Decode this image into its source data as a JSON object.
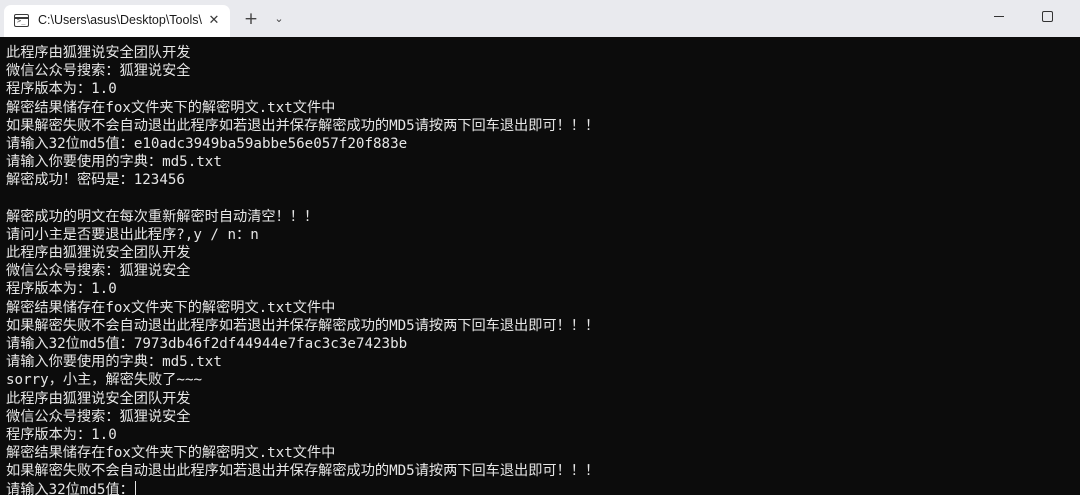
{
  "tab": {
    "title": "C:\\Users\\asus\\Desktop\\Tools\\",
    "close_glyph": "✕",
    "new_tab_glyph": "+",
    "dropdown_glyph": "⌄",
    "icon": "terminal-icon",
    "icon_prompt": ">_"
  },
  "window_controls": {
    "minimize": "minimize-icon",
    "maximize": "maximize-icon"
  },
  "terminal": {
    "lines": [
      "此程序由狐狸说安全团队开发",
      "微信公众号搜索：狐狸说安全",
      "程序版本为：1.0",
      "解密结果储存在fox文件夹下的解密明文.txt文件中",
      "如果解密失败不会自动退出此程序如若退出并保存解密成功的MD5请按两下回车退出即可！！！",
      "请输入32位md5值：e10adc3949ba59abbe56e057f20f883e",
      "请输入你要使用的字典：md5.txt",
      "解密成功！密码是：123456",
      "",
      "解密成功的明文在每次重新解密时自动清空！！！",
      "请问小主是否要退出此程序?,y / n：n",
      "此程序由狐狸说安全团队开发",
      "微信公众号搜索：狐狸说安全",
      "程序版本为：1.0",
      "解密结果储存在fox文件夹下的解密明文.txt文件中",
      "如果解密失败不会自动退出此程序如若退出并保存解密成功的MD5请按两下回车退出即可！！！",
      "请输入32位md5值：7973db46f2df44944e7fac3c3e7423bb",
      "请输入你要使用的字典：md5.txt",
      "sorry，小主，解密失败了~~~",
      "此程序由狐狸说安全团队开发",
      "微信公众号搜索：狐狸说安全",
      "程序版本为：1.0",
      "解密结果储存在fox文件夹下的解密明文.txt文件中",
      "如果解密失败不会自动退出此程序如若退出并保存解密成功的MD5请按两下回车退出即可！！！"
    ],
    "prompt_line": "请输入32位md5值："
  }
}
